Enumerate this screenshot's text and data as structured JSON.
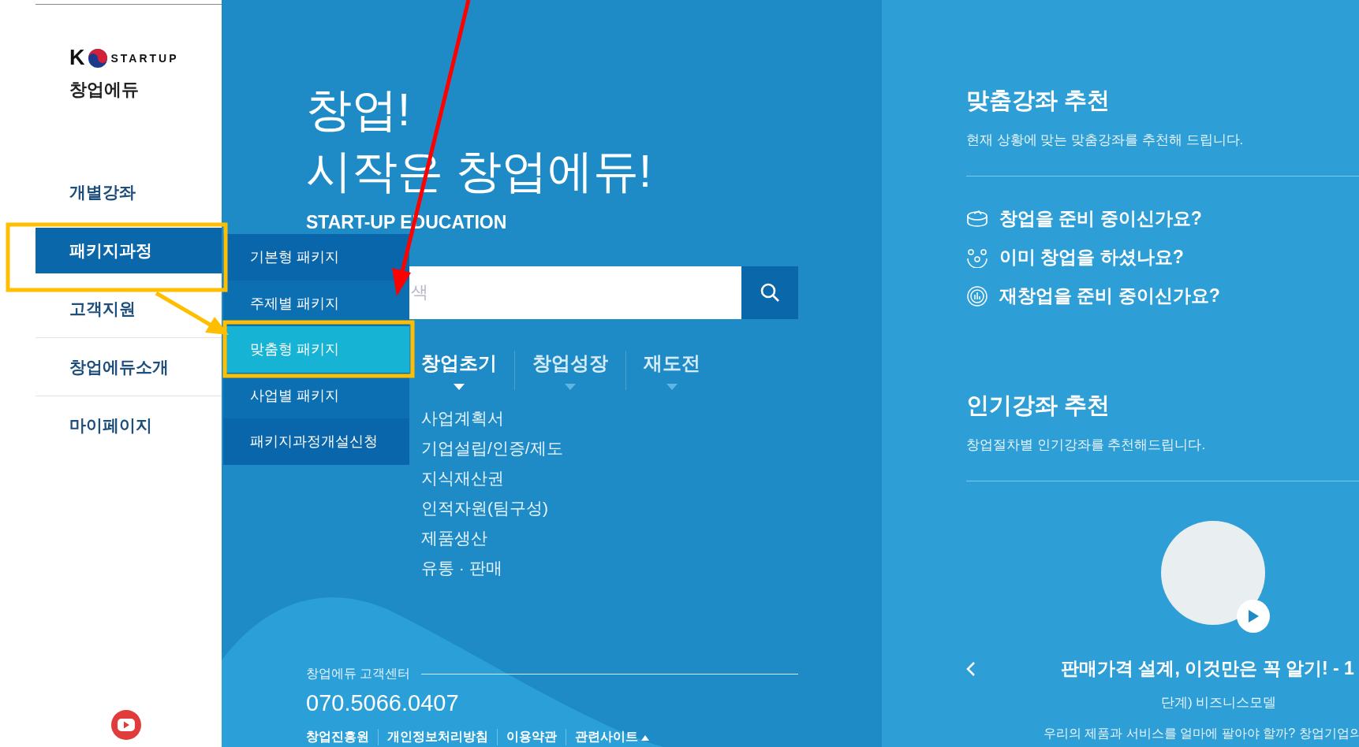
{
  "logo": {
    "mark": "K",
    "word": "STARTUP",
    "site_name": "창업에듀"
  },
  "nav": [
    {
      "label": "개별강좌",
      "selected": false
    },
    {
      "label": "패키지과정",
      "selected": true
    },
    {
      "label": "고객지원",
      "selected": false
    },
    {
      "label": "창업에듀소개",
      "selected": false
    },
    {
      "label": "마이페이지",
      "selected": false
    }
  ],
  "submenu": [
    {
      "label": "기본형 패키지",
      "selected": false
    },
    {
      "label": "주제별 패키지",
      "selected": false
    },
    {
      "label": "맞춤형 패키지",
      "selected": true
    },
    {
      "label": "사업별 패키지",
      "selected": false
    },
    {
      "label": "패키지과정개설신청",
      "selected": false
    }
  ],
  "hero": {
    "line1": "창업!",
    "line2": "시작은 창업에듀!",
    "subtitle": "START-UP EDUCATION"
  },
  "search": {
    "placeholder": "색"
  },
  "stage_tabs": [
    {
      "label": "창업초기",
      "selected": true
    },
    {
      "label": "창업성장",
      "selected": false
    },
    {
      "label": "재도전",
      "selected": false
    }
  ],
  "stage_items": [
    "사업계획서",
    "기업설립/인증/제도",
    "지식재산권",
    "인적자원(팀구성)",
    "제품생산",
    "유통 · 판매"
  ],
  "contact": {
    "label": "창업에듀 고객센터",
    "phone": "070.5066.0407"
  },
  "footer_links": [
    "창업진흥원",
    "개인정보처리방침",
    "이용약관",
    "관련사이트"
  ],
  "custom_courses": {
    "title": "맞춤강좌 추천",
    "subtitle": "현재 상황에 맞는 맞춤강좌를 추천해 드립니다.",
    "questions": [
      {
        "kind": "prepare",
        "text": "창업을 준비 중이신가요?"
      },
      {
        "kind": "started",
        "text": "이미 창업을 하셨나요?"
      },
      {
        "kind": "restart",
        "text": "재창업을 준비 중이신가요?"
      }
    ]
  },
  "popular_courses": {
    "title": "인기강좌 추천",
    "subtitle": "창업절차별 인기강좌를 추천해드립니다.",
    "course": {
      "title": "판매가격 설계, 이것만은 꼭 알기! - 1",
      "subtitle": "단계) 비즈니스모델",
      "description": "우리의 제품과 서비스를 얼마에 팔아야 할까? 창업기업의"
    }
  }
}
